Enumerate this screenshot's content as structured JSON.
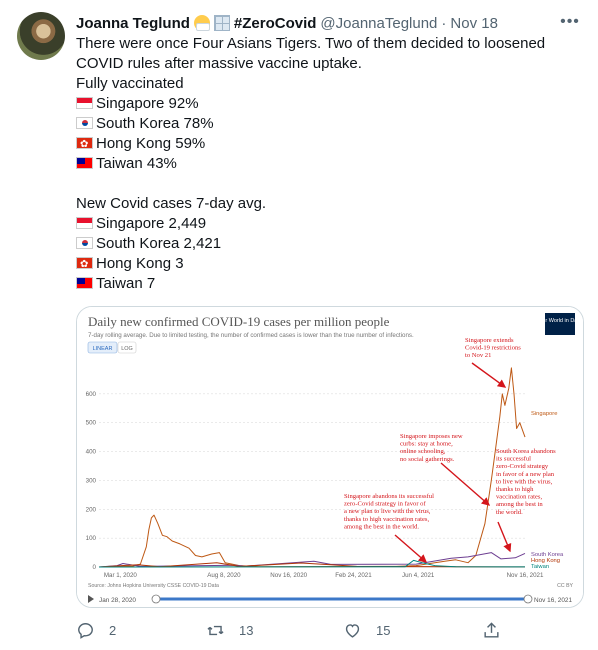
{
  "tweet": {
    "author_name": "Joanna Teglund",
    "author_name_extra": "#ZeroCovid",
    "handle": "@JoannaTeglund",
    "separator": "·",
    "date": "Nov 18",
    "lines": [
      {
        "flag": "",
        "text": "There were once Four Asians Tigers. Two of them decided to loosened"
      },
      {
        "flag": "",
        "text": "COVID rules after massive vaccine uptake."
      },
      {
        "flag": "",
        "text": "Fully vaccinated"
      },
      {
        "flag": "sg",
        "text": "Singapore 92%"
      },
      {
        "flag": "kr",
        "text": "South Korea 78%"
      },
      {
        "flag": "hk",
        "text": "Hong Kong 59%"
      },
      {
        "flag": "tw",
        "text": "Taiwan 43%"
      },
      {
        "flag": "",
        "text": ""
      },
      {
        "flag": "",
        "text": "New Covid cases 7-day avg."
      },
      {
        "flag": "sg",
        "text": "Singapore 2,449"
      },
      {
        "flag": "kr",
        "text": "South Korea 2,421"
      },
      {
        "flag": "hk",
        "text": "Hong Kong 3"
      },
      {
        "flag": "tw",
        "text": "Taiwan 7"
      }
    ],
    "icons": {
      "more": "more-icon",
      "reply": "reply-icon",
      "retweet": "retweet-icon",
      "like": "heart-icon",
      "share": "share-icon"
    }
  },
  "chart_image": {
    "title": "Daily new confirmed COVID-19 cases per million people",
    "subtitle": "7-day rolling average. Due to limited testing, the number of confirmed cases is lower than the true number of infections.",
    "logo_text": "Our World in Data",
    "toggle_linear": "LINEAR",
    "toggle_log": "LOG",
    "source": "Source: Johns Hopkins University CSSE COVID-19 Data",
    "license": "CC BY",
    "slider_start": "Jan 28, 2020",
    "slider_end": "Nov 16, 2021",
    "annotations": [
      "Singapore extends\nCovid-19 restrictions\nto Nov 21",
      "Singapore imposes new\ncurbs: stay at home,\nonline schooling,\nno social gatherings.",
      "South Korea abandons\nits successful\nzero-Covid strategy\nin favor of a new plan\nto live with the virus,\nthanks to high\nvaccination rates,\namong the best in\nthe world.",
      "Singapore abandons its successful\nzero-Covid strategy in favor of\na new plan to live with the virus,\nthanks to high vaccination rates,\namong the best in the world."
    ]
  },
  "chart_data": {
    "type": "line",
    "title": "Daily new confirmed COVID-19 cases per million people",
    "subtitle": "7-day rolling average. Due to limited testing, the number of confirmed cases is lower than the true number of infections.",
    "xlabel": "",
    "ylabel": "",
    "x_tick_labels": [
      "Mar 1, 2020",
      "Aug 8, 2020",
      "Nov 16, 2020",
      "Feb 24, 2021",
      "Jun 4, 2021",
      "Nov 16, 2021"
    ],
    "y_ticks": [
      0,
      100,
      200,
      300,
      400,
      500,
      600
    ],
    "xlim": [
      "2020-01-28",
      "2021-11-16"
    ],
    "ylim": [
      0,
      700
    ],
    "grid": true,
    "legend_placement": "right end labels",
    "series": [
      {
        "name": "Singapore",
        "color": "#be5915",
        "points": [
          [
            "2020-01-28",
            0
          ],
          [
            "2020-03-20",
            3
          ],
          [
            "2020-04-01",
            10
          ],
          [
            "2020-04-10",
            70
          ],
          [
            "2020-04-14",
            130
          ],
          [
            "2020-04-18",
            170
          ],
          [
            "2020-04-22",
            180
          ],
          [
            "2020-04-28",
            150
          ],
          [
            "2020-05-05",
            110
          ],
          [
            "2020-05-12",
            105
          ],
          [
            "2020-05-20",
            90
          ],
          [
            "2020-06-01",
            80
          ],
          [
            "2020-06-15",
            65
          ],
          [
            "2020-06-25",
            40
          ],
          [
            "2020-07-05",
            35
          ],
          [
            "2020-07-20",
            45
          ],
          [
            "2020-08-01",
            50
          ],
          [
            "2020-08-10",
            15
          ],
          [
            "2020-09-01",
            5
          ],
          [
            "2020-10-01",
            1
          ],
          [
            "2021-05-01",
            2
          ],
          [
            "2021-06-01",
            5
          ],
          [
            "2021-07-15",
            20
          ],
          [
            "2021-08-01",
            25
          ],
          [
            "2021-08-20",
            15
          ],
          [
            "2021-09-01",
            40
          ],
          [
            "2021-09-15",
            150
          ],
          [
            "2021-09-25",
            300
          ],
          [
            "2021-10-01",
            400
          ],
          [
            "2021-10-08",
            520
          ],
          [
            "2021-10-12",
            600
          ],
          [
            "2021-10-16",
            560
          ],
          [
            "2021-10-22",
            620
          ],
          [
            "2021-10-26",
            690
          ],
          [
            "2021-10-30",
            600
          ],
          [
            "2021-11-03",
            480
          ],
          [
            "2021-11-08",
            500
          ],
          [
            "2021-11-16",
            450
          ]
        ]
      },
      {
        "name": "South Korea",
        "color": "#6d3e91",
        "points": [
          [
            "2020-01-28",
            0
          ],
          [
            "2020-02-25",
            5
          ],
          [
            "2020-03-05",
            12
          ],
          [
            "2020-04-01",
            2
          ],
          [
            "2020-08-25",
            6
          ],
          [
            "2020-09-10",
            3
          ],
          [
            "2020-12-25",
            20
          ],
          [
            "2021-01-20",
            9
          ],
          [
            "2021-06-01",
            10
          ],
          [
            "2021-07-25",
            30
          ],
          [
            "2021-08-20",
            35
          ],
          [
            "2021-09-25",
            50
          ],
          [
            "2021-10-10",
            28
          ],
          [
            "2021-11-01",
            32
          ],
          [
            "2021-11-16",
            47
          ]
        ]
      },
      {
        "name": "Hong Kong",
        "color": "#b13507",
        "points": [
          [
            "2020-01-28",
            0
          ],
          [
            "2020-03-28",
            8
          ],
          [
            "2020-05-01",
            1
          ],
          [
            "2020-07-28",
            15
          ],
          [
            "2020-09-01",
            2
          ],
          [
            "2020-12-05",
            14
          ],
          [
            "2021-01-20",
            8
          ],
          [
            "2021-03-01",
            2
          ],
          [
            "2021-11-16",
            0.4
          ]
        ]
      },
      {
        "name": "Taiwan",
        "color": "#00847e",
        "points": [
          [
            "2020-01-28",
            0
          ],
          [
            "2021-05-15",
            1
          ],
          [
            "2021-05-28",
            23
          ],
          [
            "2021-06-10",
            15
          ],
          [
            "2021-07-01",
            4
          ],
          [
            "2021-08-01",
            1
          ],
          [
            "2021-11-16",
            0.3
          ]
        ]
      }
    ]
  }
}
